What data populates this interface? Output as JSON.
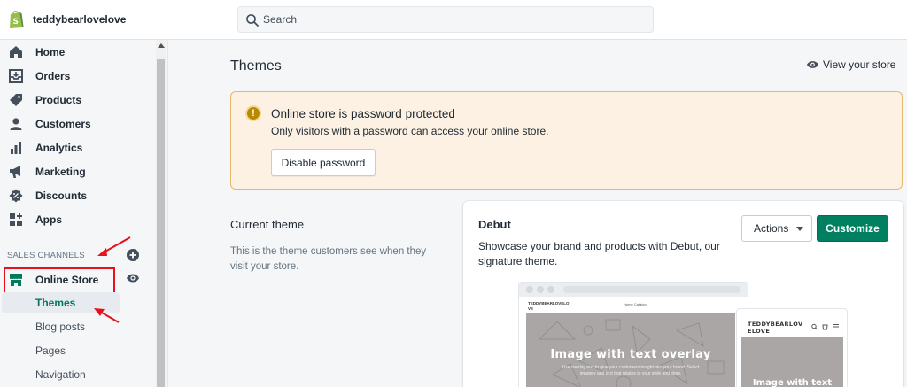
{
  "topbar": {
    "store_name": "teddybearlovelove",
    "search_placeholder": "Search"
  },
  "sidebar": {
    "items": [
      {
        "label": "Home",
        "icon": "home-icon"
      },
      {
        "label": "Orders",
        "icon": "orders-icon"
      },
      {
        "label": "Products",
        "icon": "tag-icon"
      },
      {
        "label": "Customers",
        "icon": "person-icon"
      },
      {
        "label": "Analytics",
        "icon": "bar-chart-icon"
      },
      {
        "label": "Marketing",
        "icon": "megaphone-icon"
      },
      {
        "label": "Discounts",
        "icon": "discount-icon"
      },
      {
        "label": "Apps",
        "icon": "apps-icon"
      }
    ],
    "sales_channels_heading": "SALES CHANNELS",
    "online_store": {
      "label": "Online Store",
      "icon": "store-icon"
    },
    "sub_items": [
      {
        "label": "Themes",
        "active": true
      },
      {
        "label": "Blog posts",
        "active": false
      },
      {
        "label": "Pages",
        "active": false
      },
      {
        "label": "Navigation",
        "active": false
      }
    ]
  },
  "main": {
    "title": "Themes",
    "view_store_label": "View your store",
    "banner": {
      "title": "Online store is password protected",
      "text": "Only visitors with a password can access your online store.",
      "button_label": "Disable password"
    },
    "current_theme": {
      "heading": "Current theme",
      "description": "This is the theme customers see when they visit your store."
    },
    "theme_card": {
      "name": "Debut",
      "description": "Showcase your brand and products with Debut, our signature theme.",
      "actions_label": "Actions",
      "customize_label": "Customize",
      "preview": {
        "desktop_brand": "TEDDYBEARLOVELO VE",
        "desktop_nav": "Home   Catalog",
        "hero_title": "Image with text overlay",
        "hero_subtitle": "Use overlay text to give your customers insight into your brand. Select imagery and text that relates to your style and story.",
        "mobile_brand": "TEDDYBEARLOV ELOVE",
        "mobile_hero_title": "Image with text"
      }
    }
  },
  "colors": {
    "primary": "#008060",
    "active_text": "#007a5c",
    "banner_bg": "#fcf1e2",
    "banner_border": "#e6b86a",
    "warning_icon": "#b98900",
    "annotation_red": "#e8111b"
  }
}
